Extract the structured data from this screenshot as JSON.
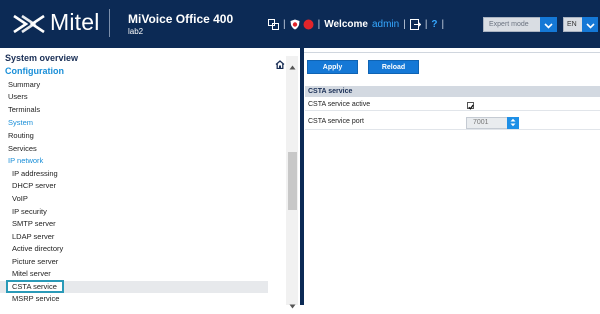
{
  "header": {
    "brand": "Mitel",
    "product": "MiVoice Office 400",
    "site": "lab2",
    "welcome_label": "Welcome",
    "user": "admin",
    "help": "?",
    "mode_value": "Expert mode",
    "language_value": "EN"
  },
  "sidebar": {
    "overview_label": "System overview",
    "config_label": "Configuration",
    "items": [
      {
        "label": "Summary"
      },
      {
        "label": "Users"
      },
      {
        "label": "Terminals"
      },
      {
        "label": "System"
      },
      {
        "label": "Routing"
      },
      {
        "label": "Services"
      },
      {
        "label": "IP network"
      }
    ],
    "subitems": [
      {
        "label": "IP addressing"
      },
      {
        "label": "DHCP server"
      },
      {
        "label": "VoIP"
      },
      {
        "label": "IP security"
      },
      {
        "label": "SMTP server"
      },
      {
        "label": "LDAP server"
      },
      {
        "label": "Active directory"
      },
      {
        "label": "Picture server"
      },
      {
        "label": "Mitel server"
      },
      {
        "label": "CSTA service"
      },
      {
        "label": "MSRP service"
      }
    ]
  },
  "main": {
    "apply_label": "Apply",
    "reload_label": "Reload",
    "section_title": "CSTA service",
    "fields": [
      {
        "label": "CSTA service active",
        "checked": true
      },
      {
        "label": "CSTA service port",
        "value": "7001"
      }
    ]
  },
  "colors": {
    "header_bg": "#0c2a55",
    "accent": "#1578d6",
    "active_link": "#1a8fd8",
    "selected_border": "#2a9ab8"
  }
}
